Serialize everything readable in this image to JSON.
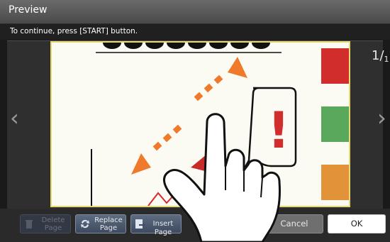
{
  "window": {
    "title": "Preview"
  },
  "info": {
    "message": "To continue, press [START] button."
  },
  "page_counter": {
    "current": "1",
    "total": "1"
  },
  "nav": {
    "prev": "‹",
    "next": "›"
  },
  "toolbar": {
    "delete_page": "Delete Page",
    "replace_page": "Replace Page",
    "insert_page": "Insert Page",
    "cancel": "Cancel",
    "ok": "OK"
  },
  "preview": {
    "symbol": "!",
    "swatch_colors": [
      "#d22d2d",
      "#5aa85c",
      "#e29238"
    ],
    "arrow_color": "#f07a2c"
  }
}
